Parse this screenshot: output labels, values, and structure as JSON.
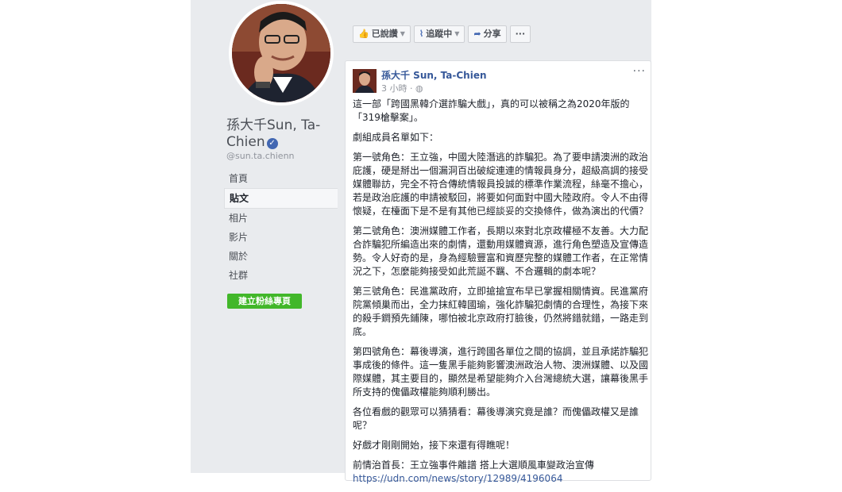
{
  "sidebar": {
    "page_name": "孫大千Sun, Ta-Chien",
    "handle": "@sun.ta.chienn",
    "nav": [
      "首頁",
      "貼文",
      "相片",
      "影片",
      "關於",
      "社群"
    ],
    "active_index": 1,
    "create_button": "建立粉絲專頁"
  },
  "actions": {
    "liked": "已說讚",
    "following": "追蹤中",
    "share": "分享",
    "more": "···"
  },
  "post": {
    "author": "孫大千 Sun, Ta-Chien",
    "time": "3 小時 ·",
    "paragraphs": [
      "這一部「跨國黑韓介選詐騙大戲」，真的可以被稱之為2020年版的「319槍擊案」。",
      "劇組成員名單如下：",
      "第一號角色：王立強，中國大陸潛逃的詐騙犯。為了要申請澳洲的政治庇護，硬是掰出一個漏洞百出破綻連連的情報員身分，超級高調的接受媒體聯訪，完全不符合傳統情報員投誠的標準作業流程，絲毫不擔心，若是政治庇護的申請被駁回，將要如何面對中國大陸政府。令人不由得懷疑，在檯面下是不是有其他已經談妥的交換條件，做為演出的代價？",
      "第二號角色：澳洲媒體工作者，長期以來對北京政權極不友善。大力配合詐騙犯所編造出來的劇情，還動用媒體資源，進行角色塑造及宣傳造勢。令人好奇的是，身為經驗豐富和資歷完整的媒體工作者，在正常情況之下，怎麼能夠接受如此荒誕不羈、不合邏輯的劇本呢？",
      "第三號角色：民進黨政府，立即搶搶宣布早已掌握相關情資。民進黨府院黨傾巢而出，全力抹紅韓國瑜，強化詐騙犯劇情的合理性，為接下來的殺手鐧預先鋪陳，哪怕被北京政府打臉後，仍然將錯就錯，一路走到底。",
      "第四號角色：幕後導演，進行跨國各單位之間的協調，並且承諾詐騙犯事成後的條件。這一隻黑手能夠影響澳洲政治人物、澳洲媒體、以及國際媒體，其主要目的，顯然是希望能夠介入台灣總統大選，讓幕後黑手所支持的傀儡政權能夠順利勝出。",
      "各位看戲的觀眾可以猜猜看：幕後導演究竟是誰？而傀儡政權又是誰呢？",
      "好戲才剛剛開始，接下來還有得瞧呢！",
      "前情治首長：王立強事件離譜 搭上大選順風車變政治宣傳"
    ],
    "link": "https://udn.com/news/story/12989/4196064"
  }
}
